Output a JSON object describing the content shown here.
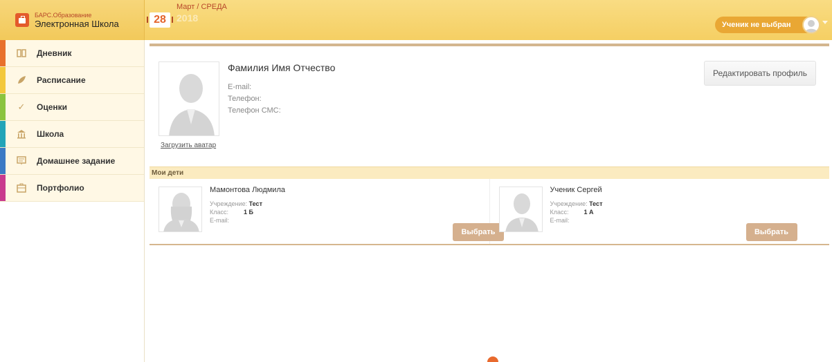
{
  "brand": {
    "small": "БАРС.Образование",
    "title": "Электронная Школа",
    "logo_icon": "briefcase-icon"
  },
  "date": {
    "day": "28",
    "month_weekday": "Март / СРЕДА",
    "year": "2018"
  },
  "user_selector": {
    "label": "Ученик не выбран",
    "avatar_icon": "user-avatar-icon"
  },
  "sidebar": {
    "items": [
      {
        "label": "Дневник",
        "icon": "book-icon",
        "color": "#e8712c"
      },
      {
        "label": "Расписание",
        "icon": "leaf-icon",
        "color": "#f3c83d"
      },
      {
        "label": "Оценки",
        "icon": "check-icon",
        "color": "#8ac43f"
      },
      {
        "label": "Школа",
        "icon": "school-building-icon",
        "color": "#22a4b8"
      },
      {
        "label": "Домашнее задание",
        "icon": "homework-icon",
        "color": "#3b7ac5"
      },
      {
        "label": "Портфолио",
        "icon": "portfolio-icon",
        "color": "#c93b8e"
      }
    ]
  },
  "profile": {
    "name": "Фамилия Имя Отчество",
    "email_label": "E-mail:",
    "phone_label": "Телефон:",
    "sms_phone_label": "Телефон СМС:",
    "upload_avatar": "Загрузить аватар",
    "edit_button": "Редактировать профиль"
  },
  "children": {
    "header": "Мои дети",
    "institution_label": "Учреждение:",
    "class_label": "Класс:",
    "email_label": "E-mail:",
    "choose_button": "Выбрать",
    "items": [
      {
        "name": "Мамонтова Людмила",
        "institution": "Тест",
        "class": "1 Б"
      },
      {
        "name": "Ученик Сергей",
        "institution": "Тест",
        "class": "1 А"
      }
    ]
  }
}
